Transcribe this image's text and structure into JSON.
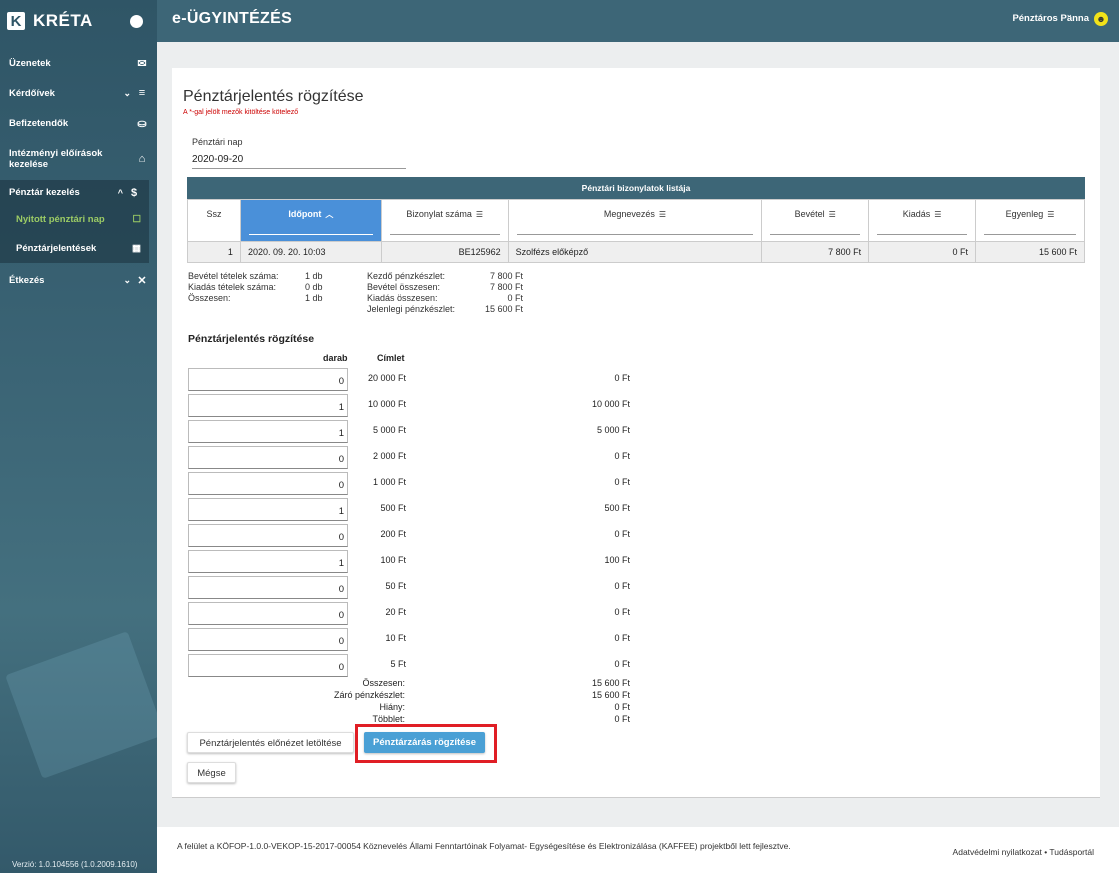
{
  "sidebar": {
    "brand_letter": "K",
    "brand_name": "KRÉTA",
    "items": {
      "uzenetek": "Üzenetek",
      "kerdoivek": "Kérdőívek",
      "befizetendok": "Befizetendők",
      "intezmenyi": "Intézményi előírások kezelése",
      "penztar": "Pénztár kezelés",
      "nyitott": "Nyitott pénztári nap",
      "jelentesek": "Pénztárjelentések",
      "etkezes": "Étkezés"
    },
    "version": "Verzió: 1.0.104556 (1.0.2009.1610)"
  },
  "topbar": {
    "title": "e-ÜGYINTÉZÉS",
    "user": "Pénztáros Panna"
  },
  "page": {
    "title": "Pénztárjelentés rögzítése",
    "required_note": "A *-gal jelölt mezők kitöltése kötelező",
    "date_label": "Pénztári nap",
    "date_value": "2020-09-20"
  },
  "table": {
    "title": "Pénztári bizonylatok listája",
    "headers": [
      "Ssz",
      "Időpont",
      "Bizonylat száma",
      "Megnevezés",
      "Bevétel",
      "Kiadás",
      "Egyenleg"
    ],
    "row": [
      "1",
      "2020. 09. 20. 10:03",
      "BE125962",
      "Szolfézs előképző",
      "7 800 Ft",
      "0 Ft",
      "15 600 Ft"
    ]
  },
  "stats_left": [
    {
      "k": "Bevétel tételek száma:",
      "v": "1 db"
    },
    {
      "k": "Kiadás tételek száma:",
      "v": "0 db"
    },
    {
      "k": "Összesen:",
      "v": "1 db"
    }
  ],
  "stats_right": [
    {
      "k": "Kezdő pénzkészlet:",
      "v": "7 800 Ft"
    },
    {
      "k": "Bevétel összesen:",
      "v": "7 800 Ft"
    },
    {
      "k": "Kiadás összesen:",
      "v": "0 Ft"
    },
    {
      "k": "Jelenlegi pénzkészlet:",
      "v": "15 600 Ft"
    }
  ],
  "report": {
    "title": "Pénztárjelentés rögzítése",
    "col_count": "darab",
    "col_face": "Címlet",
    "rows": [
      {
        "count": "0",
        "face": "20 000 Ft",
        "sum": "0 Ft"
      },
      {
        "count": "1",
        "face": "10 000 Ft",
        "sum": "10 000 Ft"
      },
      {
        "count": "1",
        "face": "5 000 Ft",
        "sum": "5 000 Ft"
      },
      {
        "count": "0",
        "face": "2 000 Ft",
        "sum": "0 Ft"
      },
      {
        "count": "0",
        "face": "1 000 Ft",
        "sum": "0 Ft"
      },
      {
        "count": "1",
        "face": "500 Ft",
        "sum": "500 Ft"
      },
      {
        "count": "0",
        "face": "200 Ft",
        "sum": "0 Ft"
      },
      {
        "count": "1",
        "face": "100 Ft",
        "sum": "100 Ft"
      },
      {
        "count": "0",
        "face": "50 Ft",
        "sum": "0 Ft"
      },
      {
        "count": "0",
        "face": "20 Ft",
        "sum": "0 Ft"
      },
      {
        "count": "0",
        "face": "10 Ft",
        "sum": "0 Ft"
      },
      {
        "count": "0",
        "face": "5 Ft",
        "sum": "0 Ft"
      }
    ],
    "totals": [
      {
        "k": "Összesen:",
        "v": "15 600 Ft"
      },
      {
        "k": "Záró pénzkészlet:",
        "v": "15 600 Ft"
      },
      {
        "k": "Hiány:",
        "v": "0 Ft"
      },
      {
        "k": "Többlet:",
        "v": "0 Ft"
      }
    ]
  },
  "buttons": {
    "preview": "Pénztárjelentés előnézet letöltése",
    "close": "Pénztárzárás rögzítése",
    "cancel": "Mégse"
  },
  "footer": {
    "text": "A felület a KÖFOP-1.0.0-VEKOP-15-2017-00054 Köznevelés Állami Fenntartóinak Folyamat- Egységesítése és Elektronizálása (KAFFEE) projektből lett fejlesztve.",
    "privacy": "Adatvédelmi nyilatkozat",
    "sep": "•",
    "portal": "Tudásportál"
  },
  "colors": {
    "sidebar": "#2f5566",
    "topbar": "#3d6677",
    "accent_active": "#4a90d9",
    "primary_button": "#4aa0d5",
    "highlight": "#e01e25",
    "nav_active_text": "#9ccc65"
  }
}
